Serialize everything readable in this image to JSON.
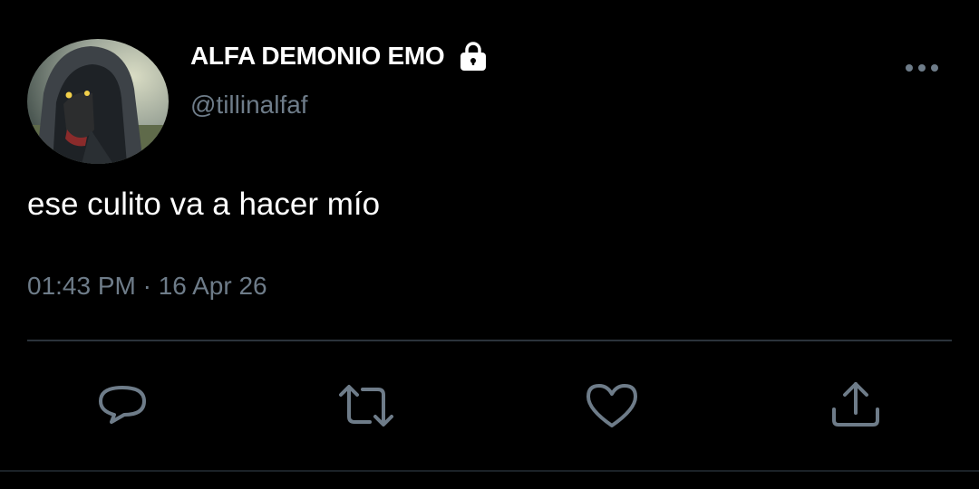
{
  "tweet": {
    "display_name": "ALFA DEMONIO EMO",
    "handle": "@tillinalfaf",
    "text": "ese culito va a hacer mío",
    "timestamp": "01:43 PM · 16 Apr 26",
    "protected_icon": "lock-icon",
    "avatar": "hooded-wolf-avatar"
  },
  "actions": {
    "reply_icon": "reply-icon",
    "retweet_icon": "retweet-icon",
    "like_icon": "heart-icon",
    "share_icon": "share-icon",
    "more_icon": "more-dots-icon"
  },
  "colors": {
    "background": "#000000",
    "primary_text": "#ffffff",
    "secondary_text": "#6e7c89",
    "icon": "#6e7c89",
    "divider": "#2b333b"
  }
}
